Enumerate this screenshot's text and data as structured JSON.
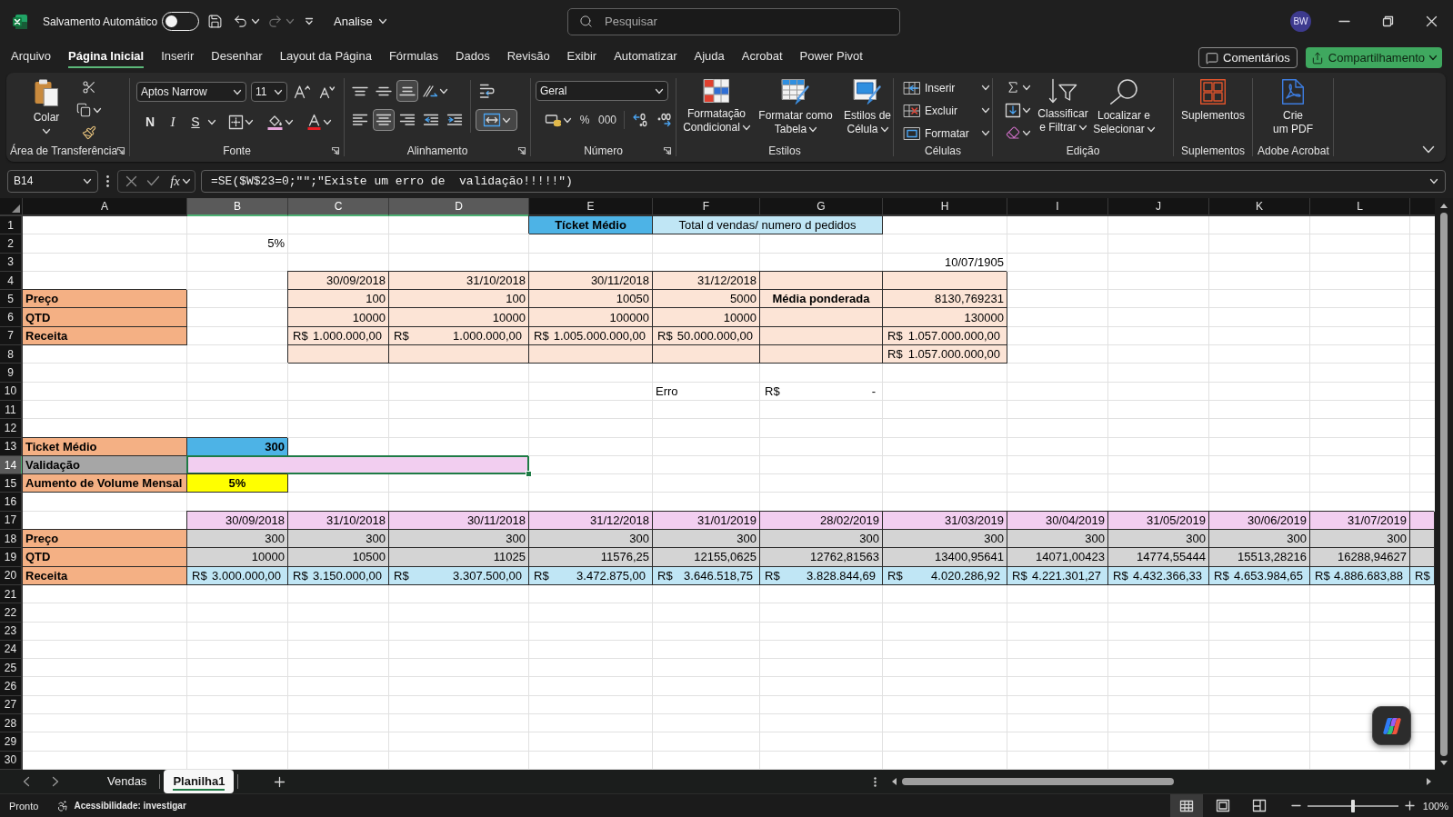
{
  "title_bar": {
    "autosave": {
      "label": "Salvamento Automático",
      "on": false
    },
    "file_name": "Analise",
    "search": {
      "placeholder": "Pesquisar"
    },
    "avatar": "BW"
  },
  "menu": {
    "tabs": [
      {
        "label": "Arquivo",
        "selected": false
      },
      {
        "label": "Página Inicial",
        "selected": true
      },
      {
        "label": "Inserir",
        "selected": false
      },
      {
        "label": "Desenhar",
        "selected": false
      },
      {
        "label": "Layout da Página",
        "selected": false
      },
      {
        "label": "Fórmulas",
        "selected": false
      },
      {
        "label": "Dados",
        "selected": false
      },
      {
        "label": "Revisão",
        "selected": false
      },
      {
        "label": "Exibir",
        "selected": false
      },
      {
        "label": "Automatizar",
        "selected": false
      },
      {
        "label": "Ajuda",
        "selected": false
      },
      {
        "label": "Acrobat",
        "selected": false
      },
      {
        "label": "Power Pivot",
        "selected": false
      }
    ],
    "comments": "Comentários",
    "share": "Compartilhamento"
  },
  "ribbon": {
    "clipboard": {
      "title": "Área de Transferência",
      "paste": "Colar"
    },
    "font": {
      "title": "Fonte",
      "family": "Aptos Narrow",
      "size": "11",
      "styles": [
        {
          "kind": "bold",
          "label": "N"
        },
        {
          "kind": "italic",
          "label": "I"
        },
        {
          "kind": "underline",
          "label": "S"
        }
      ]
    },
    "alignment": {
      "title": "Alinhamento",
      "vertical": [
        {
          "kind": "top",
          "selected": false
        },
        {
          "kind": "middle",
          "selected": false
        },
        {
          "kind": "bottom",
          "selected": true
        }
      ],
      "horizontal": [
        {
          "kind": "left",
          "selected": false
        },
        {
          "kind": "center",
          "selected": true
        },
        {
          "kind": "right",
          "selected": false
        }
      ],
      "merge": {
        "selected": true
      }
    },
    "number": {
      "title": "Número",
      "format": "Geral",
      "percent": "%",
      "thousands": "000"
    },
    "styles": {
      "title": "Estilos",
      "buttons": [
        {
          "kind": "conditional",
          "lines": [
            "Formatação",
            "Condicional"
          ]
        },
        {
          "kind": "table",
          "lines": [
            "Formatar como",
            "Tabela"
          ]
        },
        {
          "kind": "cell_styles",
          "lines": [
            "Estilos de",
            "Célula"
          ]
        }
      ]
    },
    "cells": {
      "title": "Células",
      "buttons": [
        {
          "kind": "insert",
          "label": "Inserir"
        },
        {
          "kind": "delete",
          "label": "Excluir"
        },
        {
          "kind": "format",
          "label": "Formatar"
        }
      ]
    },
    "editing": {
      "title": "Edição",
      "buttons": [
        {
          "kind": "sort",
          "lines": [
            "Classificar",
            "e Filtrar"
          ]
        },
        {
          "kind": "find",
          "lines": [
            "Localizar e",
            "Selecionar"
          ]
        }
      ]
    },
    "addins": {
      "title": "Suplementos",
      "label": "Suplementos"
    },
    "acrobat": {
      "title": "Adobe Acrobat",
      "lines": [
        "Crie",
        "um PDF"
      ]
    }
  },
  "formula_bar": {
    "name_box": "B14",
    "fx": "fx",
    "formula": "=SE($W$23=0;\"\";\"Existe um erro de  validação!!!!!\")"
  },
  "sheet": {
    "columns": [
      {
        "label": "A",
        "selected": false
      },
      {
        "label": "B",
        "selected": true
      },
      {
        "label": "C",
        "selected": true
      },
      {
        "label": "D",
        "selected": true
      },
      {
        "label": "E",
        "selected": false
      },
      {
        "label": "F",
        "selected": false
      },
      {
        "label": "G",
        "selected": false
      },
      {
        "label": "H",
        "selected": false
      },
      {
        "label": "I",
        "selected": false
      },
      {
        "label": "J",
        "selected": false
      },
      {
        "label": "K",
        "selected": false
      },
      {
        "label": "L",
        "selected": false
      }
    ],
    "rows": [
      {
        "label": "1",
        "selected": false,
        "cells": [
          {
            "kind": "empty"
          },
          {
            "kind": "empty"
          },
          {
            "kind": "empty"
          },
          {
            "kind": "empty"
          },
          {
            "kind": "title",
            "text": "Tícket Médio",
            "color": "#4db3e6"
          },
          {
            "kind": "caption",
            "text": "Total d vendas/ numero d pedidos",
            "color": "#c0e6f5"
          },
          {
            "kind": "merged"
          }
        ]
      },
      {
        "label": "2",
        "selected": false,
        "cells": [
          {
            "kind": "empty"
          },
          {
            "kind": "number",
            "text": "5%"
          }
        ]
      },
      {
        "label": "3",
        "selected": false,
        "cells": [
          {
            "kind": "empty"
          },
          {
            "kind": "empty"
          },
          {
            "kind": "empty"
          },
          {
            "kind": "empty"
          },
          {
            "kind": "empty"
          },
          {
            "kind": "empty"
          },
          {
            "kind": "empty"
          },
          {
            "kind": "number",
            "text": "10/07/1905"
          }
        ]
      },
      {
        "label": "4",
        "selected": false,
        "cells": [
          {
            "kind": "empty"
          },
          {
            "kind": "empty"
          },
          {
            "kind": "number",
            "text": "30/09/2018",
            "color": "#fce4d6"
          },
          {
            "kind": "number",
            "text": "31/10/2018",
            "color": "#fce4d6"
          },
          {
            "kind": "number",
            "text": "30/11/2018",
            "color": "#fce4d6"
          },
          {
            "kind": "number",
            "text": "31/12/2018",
            "color": "#fce4d6"
          },
          {
            "kind": "blank",
            "color": "#fce4d6"
          },
          {
            "kind": "blank",
            "color": "#fce4d6"
          }
        ]
      },
      {
        "label": "5",
        "selected": false,
        "cells": [
          {
            "kind": "label",
            "text": "Preço",
            "color": "#f4b084"
          },
          {
            "kind": "empty"
          },
          {
            "kind": "number",
            "text": "100",
            "color": "#fce4d6"
          },
          {
            "kind": "number",
            "text": "100",
            "color": "#fce4d6"
          },
          {
            "kind": "number",
            "text": "10050",
            "color": "#fce4d6"
          },
          {
            "kind": "number",
            "text": "5000",
            "color": "#fce4d6"
          },
          {
            "kind": "title",
            "text": "Média ponderada",
            "color": "#fce4d6"
          },
          {
            "kind": "number",
            "text": "8130,769231",
            "color": "#fce4d6"
          }
        ]
      },
      {
        "label": "6",
        "selected": false,
        "cells": [
          {
            "kind": "label",
            "text": "QTD",
            "color": "#f4b084"
          },
          {
            "kind": "empty"
          },
          {
            "kind": "number",
            "text": "10000",
            "color": "#fce4d6"
          },
          {
            "kind": "number",
            "text": "10000",
            "color": "#fce4d6"
          },
          {
            "kind": "number",
            "text": "100000",
            "color": "#fce4d6"
          },
          {
            "kind": "number",
            "text": "10000",
            "color": "#fce4d6"
          },
          {
            "kind": "blank",
            "color": "#fce4d6"
          },
          {
            "kind": "number",
            "text": "130000",
            "color": "#fce4d6"
          }
        ]
      },
      {
        "label": "7",
        "selected": false,
        "cells": [
          {
            "kind": "label",
            "text": "Receita",
            "color": "#f4b084"
          },
          {
            "kind": "empty"
          },
          {
            "kind": "currency",
            "symbol": "R$",
            "text": "1.000.000,00",
            "color": "#fce4d6"
          },
          {
            "kind": "currency",
            "symbol": "R$",
            "text": "1.000.000,00",
            "color": "#fce4d6"
          },
          {
            "kind": "currency",
            "symbol": "R$",
            "text": "1.005.000.000,00",
            "color": "#fce4d6"
          },
          {
            "kind": "currency",
            "symbol": "R$",
            "text": "50.000.000,00",
            "color": "#fce4d6"
          },
          {
            "kind": "blank",
            "color": "#fce4d6"
          },
          {
            "kind": "currency",
            "symbol": "R$",
            "text": "1.057.000.000,00",
            "color": "#fce4d6"
          }
        ]
      },
      {
        "label": "8",
        "selected": false,
        "cells": [
          {
            "kind": "empty"
          },
          {
            "kind": "empty"
          },
          {
            "kind": "blank",
            "color": "#fce4d6"
          },
          {
            "kind": "blank",
            "color": "#fce4d6"
          },
          {
            "kind": "blank",
            "color": "#fce4d6"
          },
          {
            "kind": "blank",
            "color": "#fce4d6"
          },
          {
            "kind": "blank",
            "color": "#fce4d6"
          },
          {
            "kind": "currency",
            "symbol": "R$",
            "text": "1.057.000.000,00",
            "color": "#fce4d6"
          }
        ]
      },
      {
        "label": "9",
        "selected": false
      },
      {
        "label": "10",
        "selected": false,
        "cells": [
          {
            "kind": "empty"
          },
          {
            "kind": "empty"
          },
          {
            "kind": "empty"
          },
          {
            "kind": "empty"
          },
          {
            "kind": "empty"
          },
          {
            "kind": "text",
            "text": "Erro"
          },
          {
            "kind": "currency",
            "symbol": "R$",
            "text": "-"
          }
        ]
      },
      {
        "label": "11",
        "selected": false
      },
      {
        "label": "12",
        "selected": false
      },
      {
        "label": "13",
        "selected": false,
        "cells": [
          {
            "kind": "label",
            "text": "Ticket Médio",
            "color": "#f4b084"
          },
          {
            "kind": "strong_number",
            "text": "300",
            "color": "#4db3e6"
          }
        ]
      },
      {
        "label": "14",
        "selected": true,
        "cells": [
          {
            "kind": "label",
            "text": "Validação",
            "color": "#a6a6a6"
          },
          {
            "kind": "blank",
            "color": "#f2cef0"
          },
          {
            "kind": "merged"
          },
          {
            "kind": "merged"
          }
        ]
      },
      {
        "label": "15",
        "selected": false,
        "cells": [
          {
            "kind": "label",
            "text": "Aumento de Volume Mensal",
            "color": "#f4b084"
          },
          {
            "kind": "title",
            "text": "5%",
            "color": "#ffff00"
          }
        ]
      },
      {
        "label": "16",
        "selected": false
      },
      {
        "label": "17",
        "selected": false,
        "cells": [
          {
            "kind": "empty"
          },
          {
            "kind": "number",
            "text": "30/09/2018",
            "color": "#f2cef0"
          },
          {
            "kind": "number",
            "text": "31/10/2018",
            "color": "#f2cef0"
          },
          {
            "kind": "number",
            "text": "30/11/2018",
            "color": "#f2cef0"
          },
          {
            "kind": "number",
            "text": "31/12/2018",
            "color": "#f2cef0"
          },
          {
            "kind": "number",
            "text": "31/01/2019",
            "color": "#f2cef0"
          },
          {
            "kind": "number",
            "text": "28/02/2019",
            "color": "#f2cef0"
          },
          {
            "kind": "number",
            "text": "31/03/2019",
            "color": "#f2cef0"
          },
          {
            "kind": "number",
            "text": "30/04/2019",
            "color": "#f2cef0"
          },
          {
            "kind": "number",
            "text": "31/05/2019",
            "color": "#f2cef0"
          },
          {
            "kind": "number",
            "text": "30/06/2019",
            "color": "#f2cef0"
          },
          {
            "kind": "number",
            "text": "31/07/2019",
            "color": "#f2cef0"
          },
          {
            "kind": "blank",
            "color": "#f2cef0"
          }
        ]
      },
      {
        "label": "18",
        "selected": false,
        "cells": [
          {
            "kind": "label",
            "text": "Preço",
            "color": "#f4b084"
          },
          {
            "kind": "number",
            "text": "300",
            "color": "#d4d4d4"
          },
          {
            "kind": "number",
            "text": "300",
            "color": "#d4d4d4"
          },
          {
            "kind": "number",
            "text": "300",
            "color": "#d4d4d4"
          },
          {
            "kind": "number",
            "text": "300",
            "color": "#d4d4d4"
          },
          {
            "kind": "number",
            "text": "300",
            "color": "#d4d4d4"
          },
          {
            "kind": "number",
            "text": "300",
            "color": "#d4d4d4"
          },
          {
            "kind": "number",
            "text": "300",
            "color": "#d4d4d4"
          },
          {
            "kind": "number",
            "text": "300",
            "color": "#d4d4d4"
          },
          {
            "kind": "number",
            "text": "300",
            "color": "#d4d4d4"
          },
          {
            "kind": "number",
            "text": "300",
            "color": "#d4d4d4"
          },
          {
            "kind": "number",
            "text": "300",
            "color": "#d4d4d4"
          },
          {
            "kind": "blank",
            "color": "#d4d4d4"
          }
        ]
      },
      {
        "label": "19",
        "selected": false,
        "cells": [
          {
            "kind": "label",
            "text": "QTD",
            "color": "#f4b084"
          },
          {
            "kind": "number",
            "text": "10000",
            "color": "#d4d4d4"
          },
          {
            "kind": "number",
            "text": "10500",
            "color": "#d4d4d4"
          },
          {
            "kind": "number",
            "text": "11025",
            "color": "#d4d4d4"
          },
          {
            "kind": "number",
            "text": "11576,25",
            "color": "#d4d4d4"
          },
          {
            "kind": "number",
            "text": "12155,0625",
            "color": "#d4d4d4"
          },
          {
            "kind": "number",
            "text": "12762,81563",
            "color": "#d4d4d4"
          },
          {
            "kind": "number",
            "text": "13400,95641",
            "color": "#d4d4d4"
          },
          {
            "kind": "number",
            "text": "14071,00423",
            "color": "#d4d4d4"
          },
          {
            "kind": "number",
            "text": "14774,55444",
            "color": "#d4d4d4"
          },
          {
            "kind": "number",
            "text": "15513,28216",
            "color": "#d4d4d4"
          },
          {
            "kind": "number",
            "text": "16288,94627",
            "color": "#d4d4d4"
          },
          {
            "kind": "blank",
            "color": "#d4d4d4"
          }
        ]
      },
      {
        "label": "20",
        "selected": false,
        "cells": [
          {
            "kind": "label",
            "text": "Receita",
            "color": "#f4b084"
          },
          {
            "kind": "currency",
            "symbol": "R$",
            "text": "3.000.000,00",
            "color": "#c0e6f5"
          },
          {
            "kind": "currency",
            "symbol": "R$",
            "text": "3.150.000,00",
            "color": "#c0e6f5"
          },
          {
            "kind": "currency",
            "symbol": "R$",
            "text": "3.307.500,00",
            "color": "#c0e6f5"
          },
          {
            "kind": "currency",
            "symbol": "R$",
            "text": "3.472.875,00",
            "color": "#c0e6f5"
          },
          {
            "kind": "currency",
            "symbol": "R$",
            "text": "3.646.518,75",
            "color": "#c0e6f5"
          },
          {
            "kind": "currency",
            "symbol": "R$",
            "text": "3.828.844,69",
            "color": "#c0e6f5"
          },
          {
            "kind": "currency",
            "symbol": "R$",
            "text": "4.020.286,92",
            "color": "#c0e6f5"
          },
          {
            "kind": "currency",
            "symbol": "R$",
            "text": "4.221.301,27",
            "color": "#c0e6f5"
          },
          {
            "kind": "currency",
            "symbol": "R$",
            "text": "4.432.366,33",
            "color": "#c0e6f5"
          },
          {
            "kind": "currency",
            "symbol": "R$",
            "text": "4.653.984,65",
            "color": "#c0e6f5"
          },
          {
            "kind": "currency",
            "symbol": "R$",
            "text": "4.886.683,88",
            "color": "#c0e6f5"
          },
          {
            "kind": "currency",
            "symbol": "R$",
            "color": "#c0e6f5"
          }
        ]
      },
      {
        "label": "21",
        "selected": false
      },
      {
        "label": "22",
        "selected": false
      },
      {
        "label": "23",
        "selected": false
      },
      {
        "label": "24",
        "selected": false
      },
      {
        "label": "25",
        "selected": false
      },
      {
        "label": "26",
        "selected": false
      },
      {
        "label": "27",
        "selected": false
      },
      {
        "label": "28",
        "selected": false
      },
      {
        "label": "29",
        "selected": false
      },
      {
        "label": "30",
        "selected": false
      }
    ]
  },
  "sheet_tabs": [
    {
      "label": "Vendas",
      "selected": false
    },
    {
      "label": "Planilha1",
      "selected": true
    }
  ],
  "status_bar": {
    "ready": "Pronto",
    "accessibility": "Acessibilidade: investigar",
    "views": [
      {
        "kind": "normal",
        "selected": true
      },
      {
        "kind": "page_layout",
        "selected": false
      },
      {
        "kind": "page_break",
        "selected": false
      }
    ],
    "zoom": {
      "level": 0.5,
      "reading": "100%"
    }
  }
}
